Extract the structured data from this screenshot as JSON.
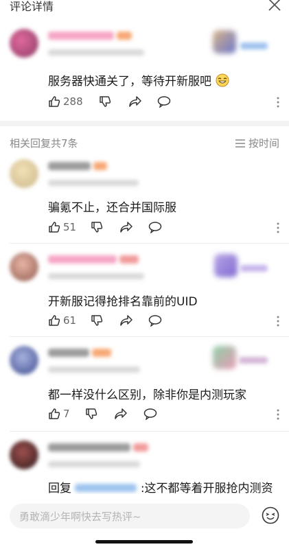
{
  "header": {
    "title": "评论详情"
  },
  "main_comment": {
    "text": "服务器快通关了，等待开新服吧",
    "likes": "288"
  },
  "replies_header": {
    "label": "相关回复共7条",
    "sort_label": "按时间"
  },
  "replies": [
    {
      "text": "骗氪不止，还合并国际服",
      "likes": "51"
    },
    {
      "text": "开新服记得抢排名靠前的UID",
      "likes": "61"
    },
    {
      "text": "都一样没什么区别，除非你是内测玩家",
      "likes": "7"
    },
    {
      "text_prefix": "回复",
      "text_suffix": ":这不都等着开服抢内测资"
    }
  ],
  "input": {
    "placeholder": "勇敢滴少年啊快去写热评~"
  },
  "icons": [
    "close-icon",
    "thumbs-up-icon",
    "thumbs-down-icon",
    "share-icon",
    "comment-icon",
    "more-icon",
    "sort-icon",
    "emoji-icon",
    "laugh-emoji-icon"
  ],
  "colors": {
    "accent_pink": "#f28ab3",
    "muted": "#888888"
  }
}
